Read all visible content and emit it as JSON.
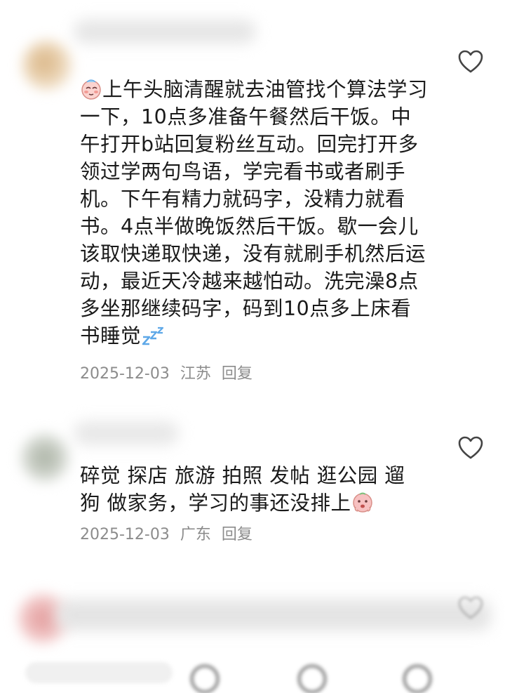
{
  "comments": [
    {
      "text": "上午头脑清醒就去油管找个算法学习一下，10点多准备午餐然后干饭。中午打开b站回复粉丝互动。回完打开多领过学两句鸟语，学完看书或者刷手机。下午有精力就码字，没精力就看书。4点半做晚饭然后干饭。歇一会儿该取快递取快递，没有就刷手机然后运动，最近天冷越来越怕动。洗完澡8点多坐那继续码字，码到10点多上床看书睡觉",
      "leading_emoji": "blushing-face-sticker",
      "trailing_emoji": "zzz-sleep-sticker",
      "date": "2025-12-03",
      "location": "江苏",
      "reply_label": "回复"
    },
    {
      "text": "碎觉 探店 旅游 拍照 发帖 逛公园 遛狗 做家务，学习的事还没排上",
      "trailing_emoji": "embarrassed-face-sticker",
      "date": "2025-12-03",
      "location": "广东",
      "reply_label": "回复"
    }
  ],
  "icons": {
    "like": "heart-outline-icon"
  },
  "colors": {
    "text": "#1a1a1a",
    "meta": "#8c8c8c",
    "icon": "#444444",
    "emoji_pink": "#f4a3a3",
    "emoji_blue": "#5ea8e8"
  }
}
